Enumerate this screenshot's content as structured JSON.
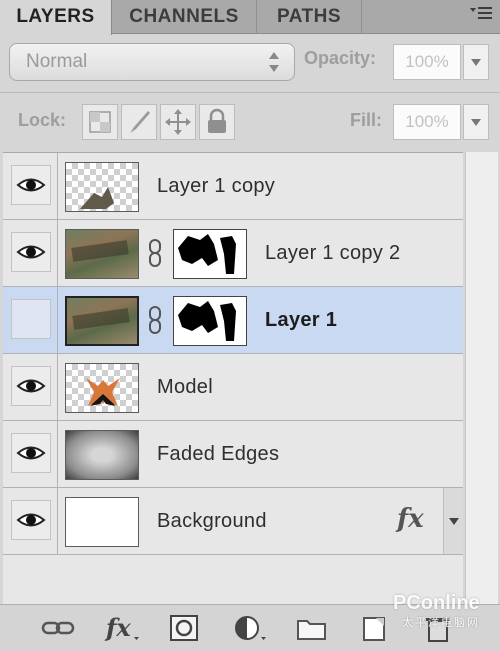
{
  "tabs": {
    "layers": "LAYERS",
    "channels": "CHANNELS",
    "paths": "PATHS"
  },
  "blend": {
    "mode": "Normal",
    "opacity_label": "Opacity:",
    "opacity_value": "100%",
    "fill_label": "Fill:",
    "fill_value": "100%"
  },
  "lock": {
    "label": "Lock:"
  },
  "layers": [
    {
      "name": "Layer 1 copy",
      "visible": true
    },
    {
      "name": "Layer 1 copy 2",
      "visible": true
    },
    {
      "name": "Layer 1",
      "visible": false,
      "selected": true
    },
    {
      "name": "Model",
      "visible": true
    },
    {
      "name": "Faded Edges",
      "visible": true
    },
    {
      "name": "Background",
      "visible": true,
      "effects": "fx"
    }
  ],
  "watermark": {
    "brand": "PConline",
    "sub": "太平洋电脑网"
  },
  "colors": {
    "selected_row": "#c9d9f2",
    "panel_bg": "#d6d6d6"
  }
}
